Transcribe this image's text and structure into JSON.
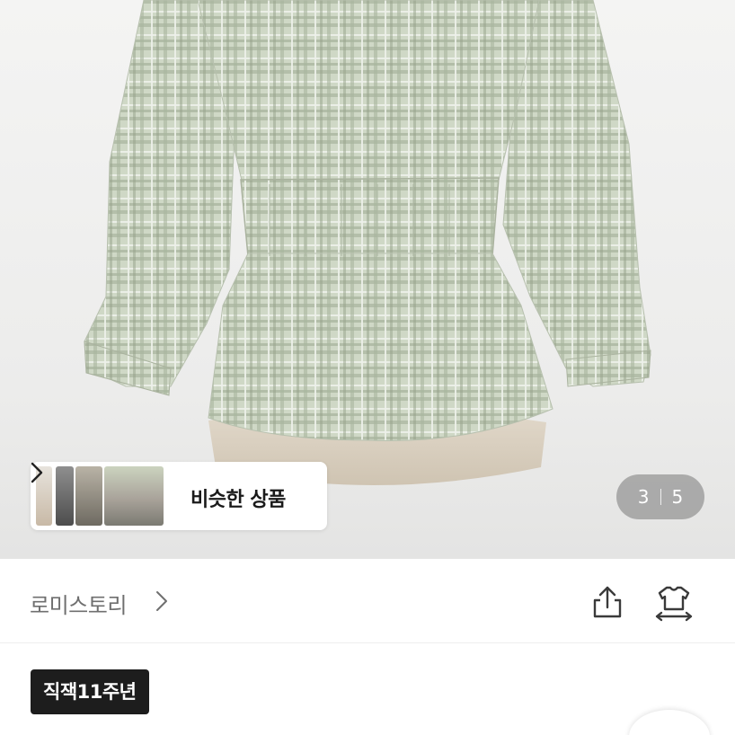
{
  "similar_products": {
    "label": "비슷한 상품",
    "chevron_icon": "chevron-right-icon"
  },
  "pager": {
    "current": "3",
    "total": "5"
  },
  "shop": {
    "name": "로미스토리",
    "chevron_icon": "chevron-right-icon",
    "share_icon": "share-icon",
    "compare_icon": "size-compare-icon"
  },
  "badge": {
    "label": "직잭11주년"
  },
  "colors": {
    "fabric_base": "#c9d3c0",
    "plaid_line": "#9aa790",
    "mannequin": "#d9cfc0",
    "badge_bg": "#1d1d1d",
    "pager_bg": "#787878"
  }
}
